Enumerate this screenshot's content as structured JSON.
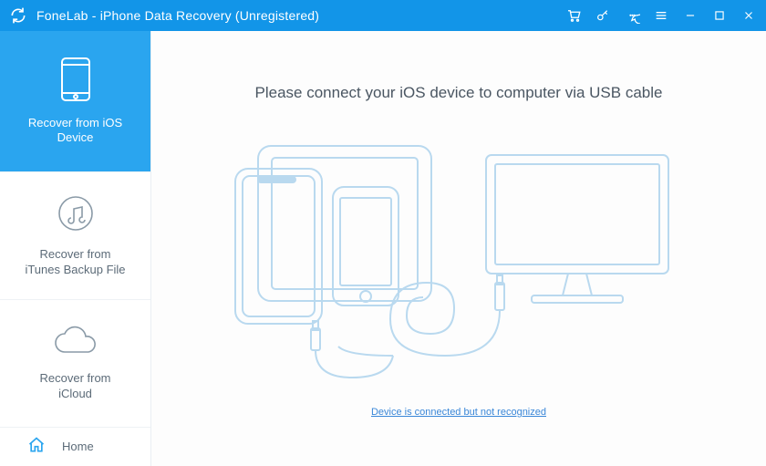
{
  "titlebar": {
    "title": "FoneLab - iPhone Data Recovery (Unregistered)"
  },
  "sidebar": {
    "items": [
      {
        "label": "Recover from iOS\nDevice"
      },
      {
        "label": "Recover from\niTunes Backup File"
      },
      {
        "label": "Recover from\niCloud"
      },
      {
        "label": "Home"
      }
    ]
  },
  "main": {
    "headline": "Please connect your iOS device to computer via USB cable",
    "help_link": "Device is connected but not recognized"
  },
  "icons": {
    "logo": "refresh-logo",
    "cart": "cart-icon",
    "key": "key-icon",
    "chat": "chat-icon",
    "menu": "menu-icon",
    "min": "minimize-icon",
    "max": "maximize-icon",
    "close": "close-icon"
  },
  "colors": {
    "accent": "#1295e8",
    "accent_light": "#2aa5ef",
    "text": "#5c6b78",
    "line": "#cfe6f5"
  }
}
